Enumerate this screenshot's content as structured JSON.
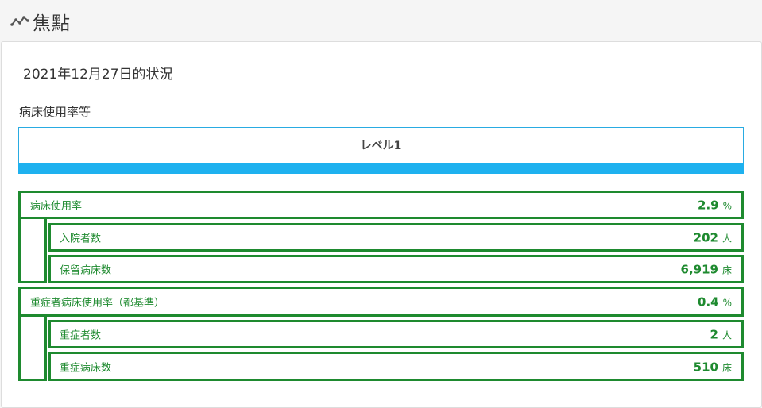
{
  "header": {
    "title": "焦點",
    "icon": "trend-line-icon"
  },
  "report": {
    "date_status": "2021年12月27日的状況",
    "section_label": "病床使用率等",
    "level_label": "レベル1",
    "level_color": "#1eb1ef"
  },
  "metrics": {
    "bed_usage": {
      "label": "病床使用率",
      "value": "2.9",
      "unit": "%"
    },
    "admitted": {
      "label": "入院者数",
      "value": "202",
      "unit": "人"
    },
    "reserved_beds": {
      "label": "保留病床数",
      "value": "6,919",
      "unit": "床"
    },
    "severe_usage": {
      "label": "重症者病床使用率（都基準）",
      "value": "0.4",
      "unit": "%"
    },
    "severe_patients": {
      "label": "重症者数",
      "value": "2",
      "unit": "人"
    },
    "severe_beds": {
      "label": "重症病床数",
      "value": "510",
      "unit": "床"
    }
  },
  "colors": {
    "accent_green": "#1e8a2f",
    "level_blue": "#1eb1ef"
  }
}
